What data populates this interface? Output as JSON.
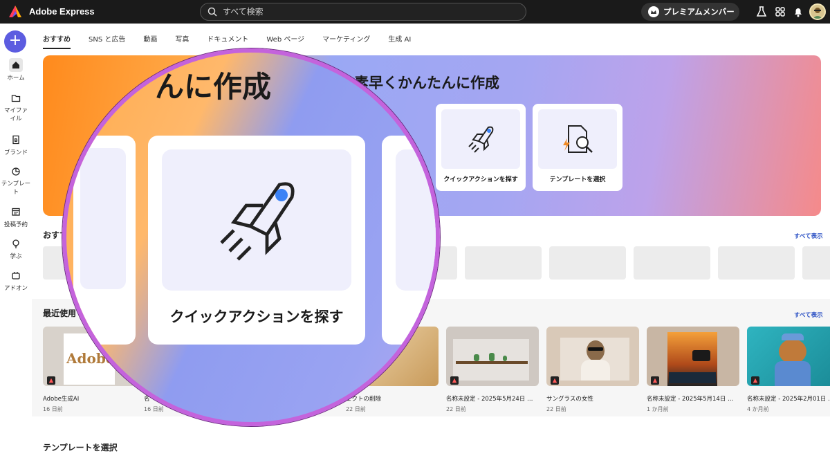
{
  "app": {
    "title": "Adobe Express"
  },
  "search": {
    "placeholder": "すべて検索"
  },
  "premium": {
    "label": "プレミアムメンバー"
  },
  "sidebar": {
    "items": [
      {
        "label": "ホーム",
        "icon": "home-icon"
      },
      {
        "label": "マイファイル",
        "icon": "folder-icon"
      },
      {
        "label": "ブランド",
        "icon": "brand-icon"
      },
      {
        "label": "テンプレート",
        "icon": "template-icon"
      },
      {
        "label": "投稿予約",
        "icon": "calendar-icon"
      },
      {
        "label": "学ぶ",
        "icon": "lightbulb-icon"
      },
      {
        "label": "アドオン",
        "icon": "addon-icon"
      }
    ]
  },
  "tabs": [
    "おすすめ",
    "SNS と広告",
    "動画",
    "写真",
    "ドキュメント",
    "Web ページ",
    "マーケティング",
    "生成 AI"
  ],
  "hero": {
    "title_partial": "素早くかんたんに作成",
    "magnified_title": "んに作成",
    "cards": [
      {
        "label": "クイックアクションを探す",
        "icon": "rocket-icon"
      },
      {
        "label": "テンプレートを選択",
        "icon": "template-search-icon"
      }
    ]
  },
  "sections": {
    "recommended_title": "おすす",
    "see_all": "すべて表示",
    "recent_title": "最近使用",
    "templates_title": "テンプレートを選択"
  },
  "recent": [
    {
      "name": "Adobe生成AI",
      "date": "16 日前"
    },
    {
      "name": "名",
      "date": "16 日前"
    },
    {
      "name": "ェクトの削除",
      "date": "22 日前"
    },
    {
      "name": "名称未設定 - 2025年5月24日 …",
      "date": "22 日前"
    },
    {
      "name": "サングラスの女性",
      "date": "22 日前"
    },
    {
      "name": "名称未設定 - 2025年5月14日 …",
      "date": "1 か月前"
    },
    {
      "name": "名称未設定 - 2025年2月01日 …",
      "date": "4 か月前"
    }
  ],
  "colors": {
    "accent": "#5c5ce0",
    "magnifier_ring": "#c463dc",
    "link": "#2a50c4"
  }
}
